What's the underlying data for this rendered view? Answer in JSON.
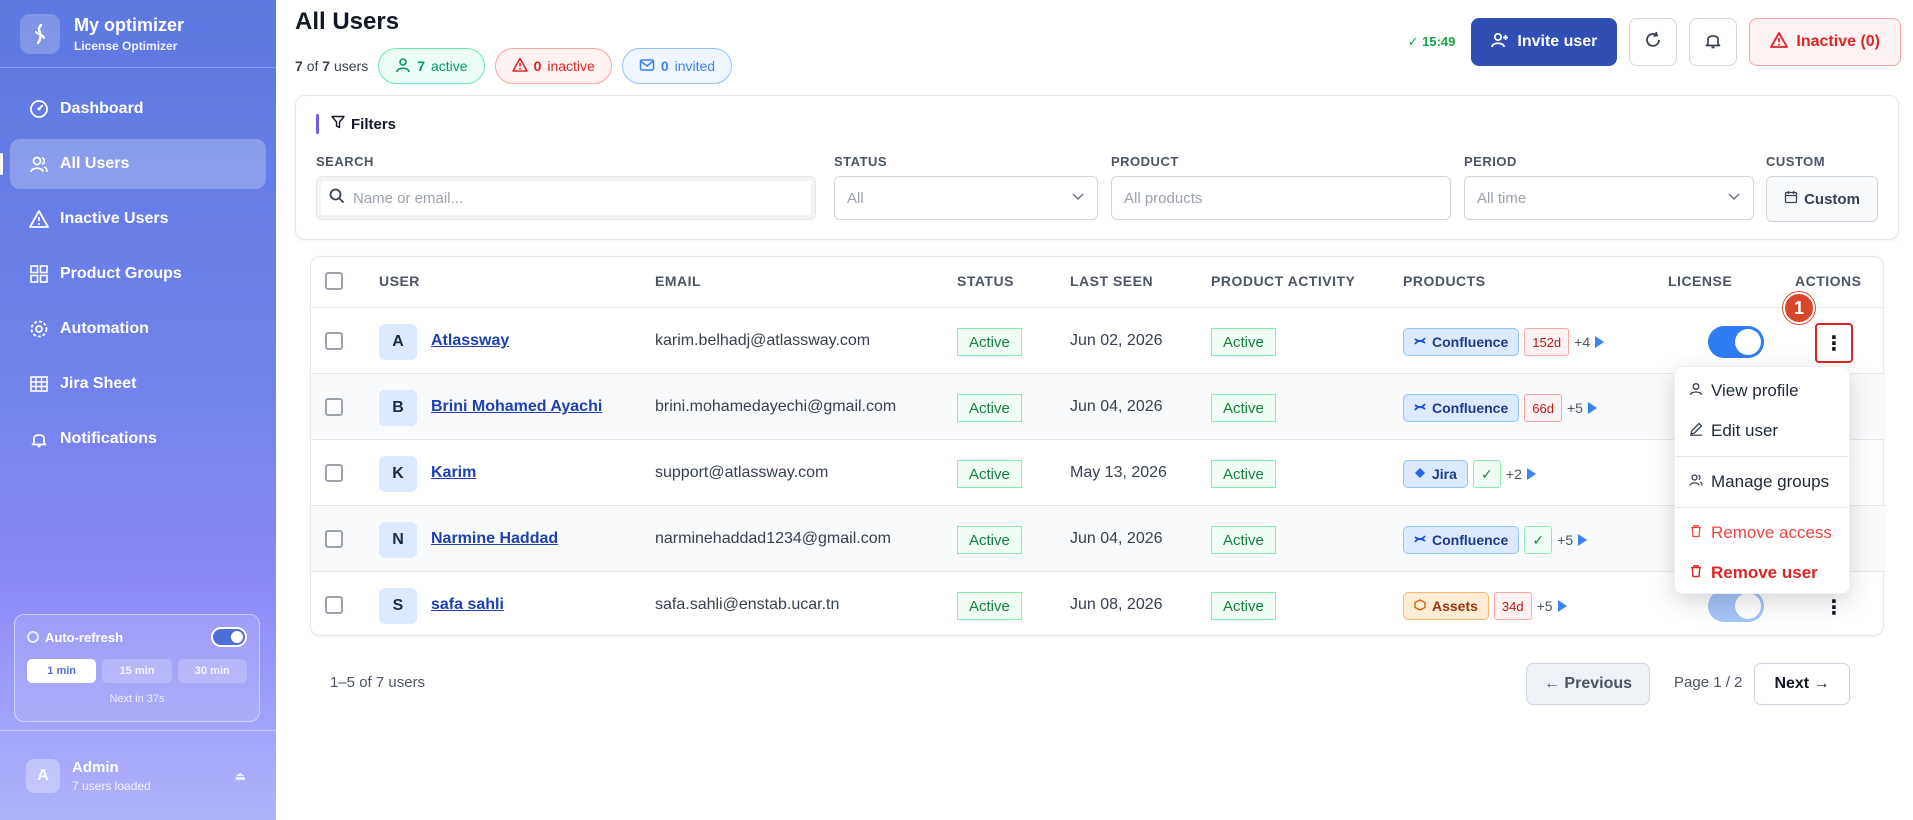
{
  "brand": {
    "title": "My optimizer",
    "subtitle": "License Optimizer"
  },
  "sidebar": {
    "items": [
      {
        "label": "Dashboard",
        "icon": "gauge-icon"
      },
      {
        "label": "All Users",
        "icon": "users-icon",
        "active": true
      },
      {
        "label": "Inactive Users",
        "icon": "warning-icon"
      },
      {
        "label": "Product Groups",
        "icon": "grid-icon"
      },
      {
        "label": "Automation",
        "icon": "gear-icon"
      },
      {
        "label": "Jira Sheet",
        "icon": "table-icon"
      },
      {
        "label": "Notifications",
        "icon": "bell-icon"
      }
    ],
    "auto_refresh": {
      "label": "Auto-refresh",
      "enabled": true,
      "options": [
        "1 min",
        "15 min",
        "30 min"
      ],
      "selected": "1 min",
      "next": "Next in 37s"
    },
    "admin": {
      "name": "Admin",
      "sub": "7 users loaded",
      "initial": "A"
    }
  },
  "header": {
    "title": "All Users",
    "count_shown": "7",
    "count_of": "of",
    "count_total": "7",
    "count_suffix": "users",
    "active_count": "7",
    "active_label": "active",
    "inactive_count": "0",
    "inactive_label": "inactive",
    "invited_count": "0",
    "invited_label": "invited",
    "time": "✓ 15:49",
    "invite_label": "Invite user",
    "inactive_button": "Inactive (0)"
  },
  "filters": {
    "title": "Filters",
    "search_label": "SEARCH",
    "search_placeholder": "Name or email...",
    "status_label": "STATUS",
    "status_value": "All",
    "product_label": "PRODUCT",
    "product_value": "All products",
    "period_label": "PERIOD",
    "period_value": "All time",
    "custom_label": "CUSTOM",
    "custom_button": "Custom"
  },
  "table": {
    "columns": [
      "USER",
      "EMAIL",
      "STATUS",
      "LAST SEEN",
      "PRODUCT ACTIVITY",
      "PRODUCTS",
      "LICENSE",
      "ACTIONS"
    ],
    "rows": [
      {
        "initial": "A",
        "name": "Atlassway",
        "email": "karim.belhadj@atlassway.com",
        "status": "Active",
        "last_seen": "Jun 02, 2026",
        "activity": "Active",
        "product": "Confluence",
        "product_type": "confluence",
        "tag": "152d",
        "tag_type": "days",
        "more": "+4"
      },
      {
        "initial": "B",
        "name": "Brini Mohamed Ayachi",
        "email": "brini.mohamedayechi@gmail.com",
        "status": "Active",
        "last_seen": "Jun 04, 2026",
        "activity": "Active",
        "product": "Confluence",
        "product_type": "confluence",
        "tag": "66d",
        "tag_type": "days",
        "more": "+5"
      },
      {
        "initial": "K",
        "name": "Karim",
        "email": "support@atlassway.com",
        "status": "Active",
        "last_seen": "May 13, 2026",
        "activity": "Active",
        "product": "Jira",
        "product_type": "jira",
        "tag": "✓",
        "tag_type": "check",
        "more": "+2"
      },
      {
        "initial": "N",
        "name": "Narmine Haddad",
        "email": "narminehaddad1234@gmail.com",
        "status": "Active",
        "last_seen": "Jun 04, 2026",
        "activity": "Active",
        "product": "Confluence",
        "product_type": "confluence",
        "tag": "✓",
        "tag_type": "check",
        "more": "+5"
      },
      {
        "initial": "S",
        "name": "safa sahli",
        "email": "safa.sahli@enstab.ucar.tn",
        "status": "Active",
        "last_seen": "Jun 08, 2026",
        "activity": "Active",
        "product": "Assets",
        "product_type": "assets",
        "tag": "34d",
        "tag_type": "days",
        "more": "+5"
      }
    ]
  },
  "pagination": {
    "range": "1–5 of 7 users",
    "prev": "← Previous",
    "page": "Page 1 / 2",
    "next": "Next →"
  },
  "menu": {
    "items": [
      "View profile",
      "Edit user",
      "Manage groups",
      "Remove access",
      "Remove user"
    ]
  },
  "marker": "1",
  "colors": {
    "primary": "#2f4fb4",
    "danger": "#dc2626",
    "success": "#15803d",
    "sidebar_top": "#5b79e0"
  }
}
